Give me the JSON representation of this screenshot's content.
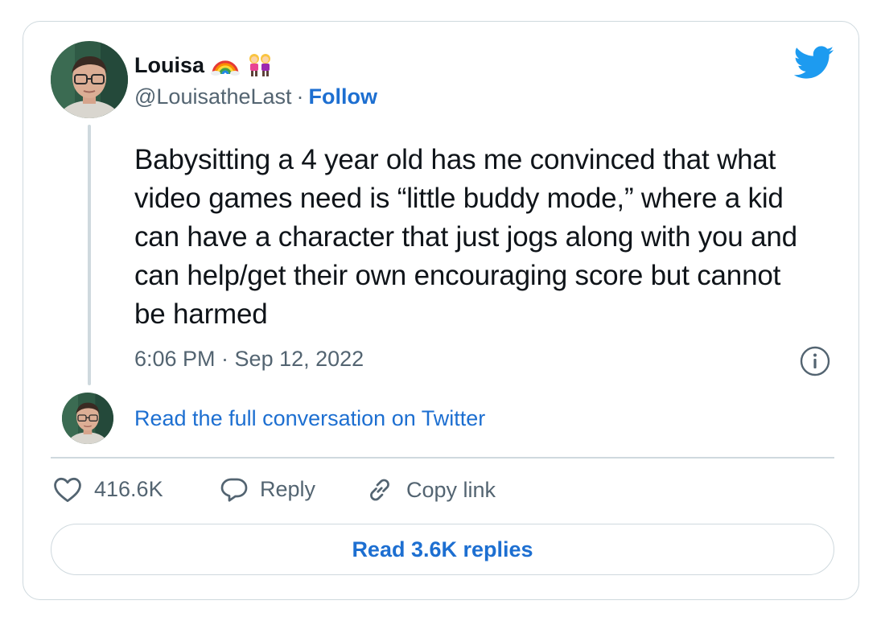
{
  "author": {
    "display_name": "Louisa",
    "handle": "@LouisatheLast",
    "separator": "·",
    "follow_label": "Follow",
    "emojis": [
      "rainbow-emoji",
      "two-women-emoji"
    ]
  },
  "tweet": {
    "text": "Babysitting a 4 year old has me convinced that what video games need is “little buddy mode,” where a kid can have a character that just jogs along with you and can help/get their own encouraging score but cannot be harmed",
    "timestamp": "6:06 PM · Sep 12, 2022"
  },
  "conversation_link": "Read the full conversation on Twitter",
  "actions": {
    "likes": "416.6K",
    "reply_label": "Reply",
    "copy_link_label": "Copy link"
  },
  "read_replies_label": "Read 3.6K replies",
  "icons": {
    "brand": "twitter-bird-icon",
    "info": "info-icon",
    "like": "heart-icon",
    "reply": "speech-bubble-icon",
    "copy": "link-icon"
  },
  "colors": {
    "link_blue": "#1d6fd1",
    "twitter_blue": "#1d9bf0",
    "text_primary": "#0f1419",
    "text_secondary": "#536471",
    "border": "#cfd9de"
  }
}
